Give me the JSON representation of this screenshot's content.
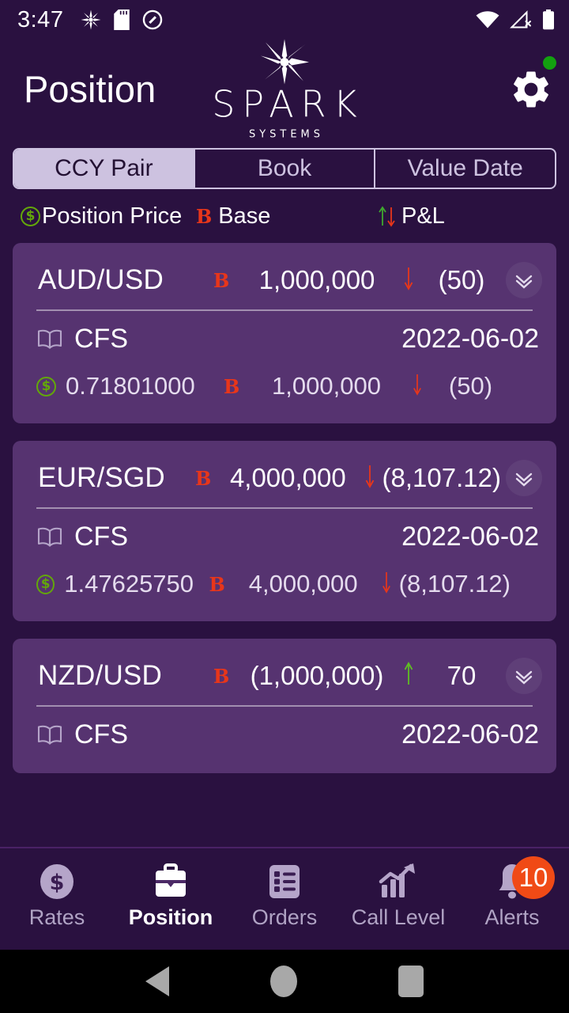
{
  "statusbar": {
    "time": "3:47",
    "left_icons": [
      "sparkle-icon",
      "sd-card-icon",
      "do-not-disturb-icon"
    ],
    "right_icons": [
      "wifi-icon",
      "no-sim-signal-icon",
      "battery-icon"
    ]
  },
  "header": {
    "title": "Position",
    "logo_word": "SPARK",
    "logo_sub": "SYSTEMS",
    "settings_icon": "gear-icon",
    "status_dot_color": "#13a010"
  },
  "tabs": {
    "items": [
      {
        "label": "CCY Pair",
        "active": true
      },
      {
        "label": "Book",
        "active": false
      },
      {
        "label": "Value Date",
        "active": false
      }
    ],
    "active_bg": "#cdc2e0",
    "active_fg": "#231133"
  },
  "legend": {
    "position_price": "Position Price",
    "base": "Base",
    "pnl": "P&L",
    "base_marker": "B",
    "base_marker_color": "#e8361a",
    "up_color": "#3fa72f",
    "down_color": "#e8361a"
  },
  "positions": [
    {
      "ccy_pair": "AUD/USD",
      "base_marker": "B",
      "amount": "1,000,000",
      "direction": "down",
      "pnl": "(50)",
      "expand_icon": "double-chevron-down-icon",
      "detail": {
        "book_icon": "book-icon",
        "book": "CFS",
        "value_date": "2022-06-02",
        "price_icon": "dollar-coin-icon",
        "price": "0.71801000",
        "base_marker": "B",
        "amount": "1,000,000",
        "direction": "down",
        "pnl": "(50)"
      }
    },
    {
      "ccy_pair": "EUR/SGD",
      "base_marker": "B",
      "amount": "4,000,000",
      "direction": "down",
      "pnl": "(8,107.12)",
      "expand_icon": "double-chevron-down-icon",
      "detail": {
        "book_icon": "book-icon",
        "book": "CFS",
        "value_date": "2022-06-02",
        "price_icon": "dollar-coin-icon",
        "price": "1.47625750",
        "base_marker": "B",
        "amount": "4,000,000",
        "direction": "down",
        "pnl": "(8,107.12)"
      }
    },
    {
      "ccy_pair": "NZD/USD",
      "base_marker": "B",
      "amount": "(1,000,000)",
      "direction": "up",
      "pnl": "70",
      "expand_icon": "double-chevron-down-icon",
      "detail": {
        "book_icon": "book-icon",
        "book": "CFS",
        "value_date": "2022-06-02",
        "price_icon": "dollar-coin-icon",
        "price": "",
        "base_marker": "",
        "amount": "",
        "direction": "",
        "pnl": ""
      }
    }
  ],
  "bottomnav": {
    "items": [
      {
        "label": "Rates",
        "icon": "dollar-circle-icon",
        "active": false
      },
      {
        "label": "Position",
        "icon": "briefcase-icon",
        "active": true
      },
      {
        "label": "Orders",
        "icon": "list-icon",
        "active": false
      },
      {
        "label": "Call Level",
        "icon": "chart-up-icon",
        "active": false
      },
      {
        "label": "Alerts",
        "icon": "bell-icon",
        "active": false,
        "badge": "10"
      }
    ],
    "badge_color": "#f04a16"
  },
  "androidnav": {
    "back": "back-triangle-icon",
    "home": "home-circle-icon",
    "recents": "recents-square-icon"
  }
}
